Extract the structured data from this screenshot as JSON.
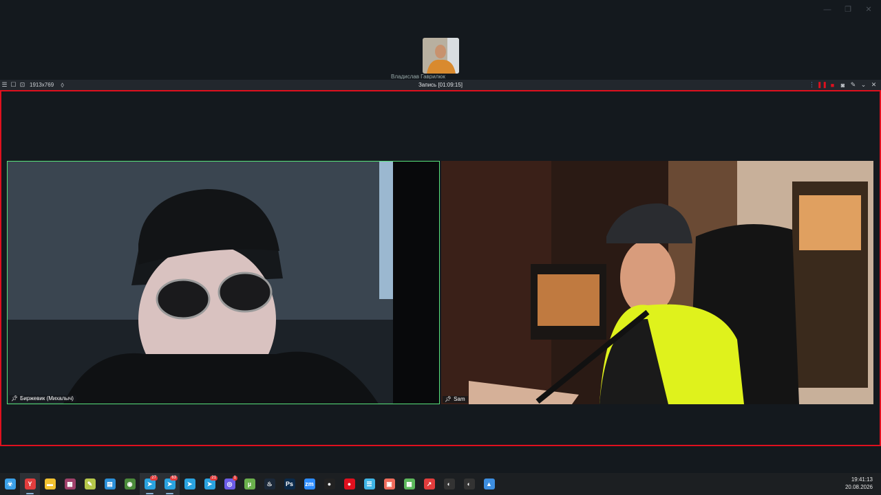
{
  "window_controls": {
    "minimize": "—",
    "restore": "❐",
    "close": "✕"
  },
  "top_participant": {
    "label": "Владислав Гаврилюк"
  },
  "recorder": {
    "dimensions": "1913x769",
    "title": "Запись [01:09:15]"
  },
  "tiles": [
    {
      "name": "Биржевик (Михалыч)",
      "active_speaker": true
    },
    {
      "name": "Sam",
      "active_speaker": false
    }
  ],
  "taskbar": {
    "apps": [
      {
        "name": "biohazard-icon",
        "color": "#3aa0e8",
        "glyph": "☣"
      },
      {
        "name": "yandex-browser-icon",
        "color": "#e23d3d",
        "glyph": "Y",
        "active": true
      },
      {
        "name": "file-explorer-icon",
        "color": "#f2c230",
        "glyph": "▬"
      },
      {
        "name": "winrar-icon",
        "color": "#a0406a",
        "glyph": "▦"
      },
      {
        "name": "notepad-plus-icon",
        "color": "#b6c84a",
        "glyph": "✎"
      },
      {
        "name": "calculator-icon",
        "color": "#2b8fd8",
        "glyph": "▤"
      },
      {
        "name": "chrome-icon",
        "color": "#4b8b3b",
        "glyph": "◉"
      },
      {
        "name": "telegram-icon",
        "color": "#2aa3e0",
        "glyph": "➤",
        "badge": "27",
        "active": true
      },
      {
        "name": "telegram-icon",
        "color": "#2aa3e0",
        "glyph": "➤",
        "badge": "63",
        "active": true
      },
      {
        "name": "telegram-icon",
        "color": "#2aa3e0",
        "glyph": "➤"
      },
      {
        "name": "telegram-icon",
        "color": "#2aa3e0",
        "glyph": "➤",
        "badge": "21"
      },
      {
        "name": "browser-icon",
        "color": "#6c5ce7",
        "glyph": "◎",
        "badge": "1"
      },
      {
        "name": "utorrent-icon",
        "color": "#6ab04c",
        "glyph": "µ"
      },
      {
        "name": "steam-icon",
        "color": "#1b2838",
        "glyph": "♨"
      },
      {
        "name": "photoshop-icon",
        "color": "#0b2a4a",
        "glyph": "Ps"
      },
      {
        "name": "zoom-icon",
        "color": "#2d8cff",
        "glyph": "zm"
      },
      {
        "name": "obs-icon",
        "color": "#222",
        "glyph": "●"
      },
      {
        "name": "record-icon",
        "color": "#e0101e",
        "glyph": "●"
      },
      {
        "name": "notes-icon",
        "color": "#3fb4e5",
        "glyph": "☰"
      },
      {
        "name": "app-icon",
        "color": "#ef6b5b",
        "glyph": "▣"
      },
      {
        "name": "spreadsheet-icon",
        "color": "#5cb85c",
        "glyph": "▦"
      },
      {
        "name": "arrow-app-icon",
        "color": "#e23d3d",
        "glyph": "↗"
      },
      {
        "name": "obs-studio-icon",
        "color": "#333",
        "glyph": "◐"
      },
      {
        "name": "obs-studio-icon",
        "color": "#333",
        "glyph": "◐"
      },
      {
        "name": "paint-icon",
        "color": "#3d8ee0",
        "glyph": "▲"
      }
    ]
  },
  "clock": {
    "time": "19:41:13",
    "date": "20.08.2026"
  }
}
